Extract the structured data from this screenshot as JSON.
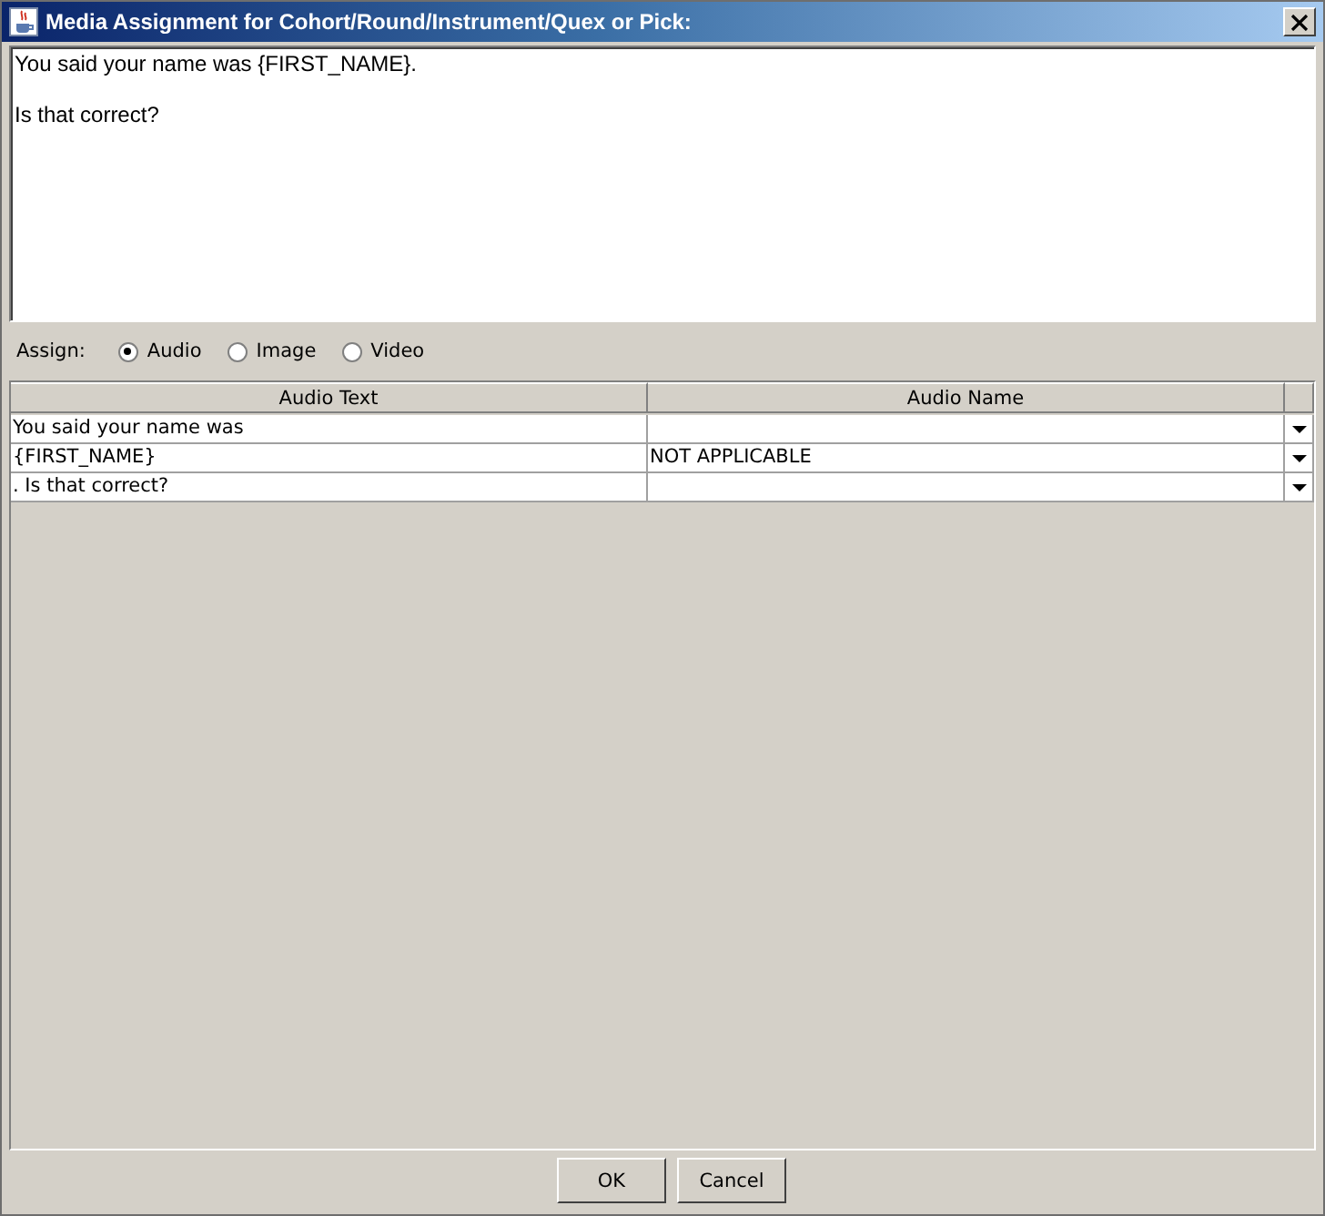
{
  "window": {
    "title": "Media Assignment for Cohort/Round/Instrument/Quex or Pick:"
  },
  "text_area": {
    "paragraphs": [
      "You said your name was {FIRST_NAME}.",
      "Is that correct?"
    ]
  },
  "assign": {
    "label": "Assign:",
    "options": [
      {
        "label": "Audio",
        "selected": true
      },
      {
        "label": "Image",
        "selected": false
      },
      {
        "label": "Video",
        "selected": false
      }
    ]
  },
  "table": {
    "columns": [
      "Audio Text",
      "Audio Name"
    ],
    "rows": [
      {
        "audio_text": "You said your name was"
      },
      {
        "audio_text": "{FIRST_NAME}",
        "audio_name": "NOT APPLICABLE"
      },
      {
        "audio_text": ".  Is that correct?"
      }
    ]
  },
  "buttons": [
    "OK",
    "Cancel"
  ]
}
